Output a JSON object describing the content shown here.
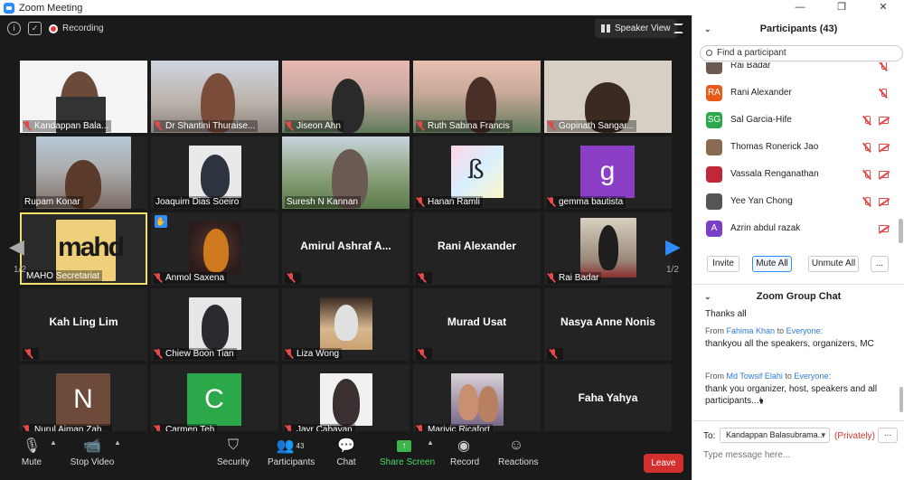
{
  "window": {
    "title": "Zoom Meeting",
    "minimize": "—",
    "maximize": "❐",
    "close": "✕"
  },
  "topbar": {
    "recording_label": "Recording",
    "view_label": "Speaker View"
  },
  "tiles": [
    [
      "Kandappan Bala...",
      "Dr Shantini Thuraise...",
      "Jiseon Ahn",
      "Ruth Sabina Francis",
      "Gopinath Sangar..."
    ],
    [
      "Rupam Konar",
      "Joaquim Dias Soeiro",
      "Suresh N Kannan",
      "Hanan Ramli",
      "gemma bautista"
    ],
    [
      "MAHO Secretariat",
      "Anmol Saxena",
      "Amirul Ashraf A...",
      "Rani Alexander",
      "Rai Badar"
    ],
    [
      "Kah Ling Lim",
      "Chiew Boon Tian",
      "Liza Wong",
      "Murad Usat",
      "Nasya Anne Nonis"
    ],
    [
      "Nurul Aiman Zah...",
      "Carmen Teh",
      "Jayr Cabayan",
      "Marivic Ricafort",
      "Faha Yahya"
    ]
  ],
  "avatars": {
    "gemma": "g",
    "nurul": "N",
    "carmen": "C"
  },
  "maho_logo_text": "mahd",
  "page_indicator_left": "1/2",
  "page_indicator_right": "1/2",
  "toolbar": {
    "mute": "Mute",
    "stop_video": "Stop Video",
    "security": "Security",
    "participants": "Participants",
    "participants_count": "43",
    "chat": "Chat",
    "share_screen": "Share Screen",
    "record": "Record",
    "reactions": "Reactions",
    "leave": "Leave"
  },
  "participants_panel": {
    "title": "Participants (43)",
    "search_placeholder": "Find a participant",
    "list": [
      {
        "name": "Rai Badar",
        "initials": "",
        "color": "#6a5a50"
      },
      {
        "name": "Rani Alexander",
        "initials": "RA",
        "color": "#e8591a"
      },
      {
        "name": "Sal Garcia-Hife",
        "initials": "SG",
        "color": "#2aa84a"
      },
      {
        "name": "Thomas Ronerick Jao",
        "initials": "",
        "color": "#8a6a50"
      },
      {
        "name": "Vassala Renganathan",
        "initials": "",
        "color": "#c0283a"
      },
      {
        "name": "Yee Yan Chong",
        "initials": "",
        "color": "#555555"
      },
      {
        "name": "Azrin abdul razak",
        "initials": "A",
        "color": "#7a3fc8"
      }
    ],
    "invite": "Invite",
    "mute_all": "Mute All",
    "unmute_all": "Unmute All",
    "more": "..."
  },
  "chat_panel": {
    "title": "Zoom Group Chat",
    "messages": [
      {
        "from": "",
        "to": "",
        "text": "Thanks all"
      },
      {
        "from": "Fahima Khan",
        "to": "Everyone:",
        "text": "thankyou all the speakers, organizers, MC"
      },
      {
        "from": "Md Towsif Elahi",
        "to": "Everyone:",
        "text": "thank you organizer, host, speakers and all participants...🖢"
      }
    ],
    "from_word": "From",
    "to_word": "to",
    "to_label": "To:",
    "to_recipient": "Kandappan Balasubrama...",
    "privately": "(Privately)",
    "more": "...",
    "input_placeholder": "Type message here..."
  },
  "colors": {
    "accent": "#2d8cff",
    "leave": "#d3302d",
    "mute_red": "#e54848",
    "maho_yellow": "#f0cf7a"
  }
}
